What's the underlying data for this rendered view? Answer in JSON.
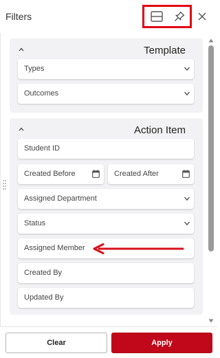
{
  "header": {
    "title": "Filters"
  },
  "sections": {
    "template": {
      "title": "Template",
      "fields": {
        "types": "Types",
        "outcomes": "Outcomes"
      }
    },
    "action_item": {
      "title": "Action Item",
      "fields": {
        "student_id": "Student ID",
        "created_before": "Created Before",
        "created_after": "Created After",
        "assigned_department": "Assigned Department",
        "status": "Status",
        "assigned_member": "Assigned Member",
        "created_by": "Created By",
        "updated_by": "Updated By"
      }
    }
  },
  "footer": {
    "clear_label": "Clear",
    "apply_label": "Apply"
  },
  "colors": {
    "accent": "#c0081a",
    "annotation": "#e00010",
    "section_bg": "#f2f2f4"
  },
  "icons": [
    "layout-icon",
    "pin-icon",
    "close-icon",
    "caret-up-icon",
    "chevron-down-icon",
    "calendar-icon",
    "drag-grip-icon"
  ]
}
